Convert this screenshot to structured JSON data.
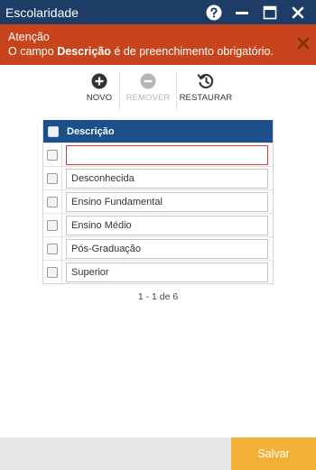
{
  "window": {
    "title": "Escolaridade",
    "buttons": [
      "help-icon",
      "minimize-icon",
      "maximize-icon",
      "close-icon"
    ]
  },
  "alert": {
    "heading": "Atenção",
    "message_prefix": "O campo ",
    "message_field": "Descrição",
    "message_suffix": " é de preenchimento obrigatório.",
    "color": "#c8441c"
  },
  "toolbar": {
    "new_label": "NOVO",
    "remove_label": "REMOVER",
    "restore_label": "RESTAURAR"
  },
  "grid": {
    "header": "Descrição",
    "header_color": "#1d4f8a",
    "rows": [
      {
        "value": "",
        "error": true
      },
      {
        "value": "Desconhecida"
      },
      {
        "value": "Ensino Fundamental"
      },
      {
        "value": "Ensino Médio"
      },
      {
        "value": "Pós-Graduação"
      },
      {
        "value": "Superior"
      }
    ]
  },
  "pager": {
    "text": "1 - 1 de 6"
  },
  "footer": {
    "save_label": "Salvar",
    "save_color": "#f2b037"
  }
}
